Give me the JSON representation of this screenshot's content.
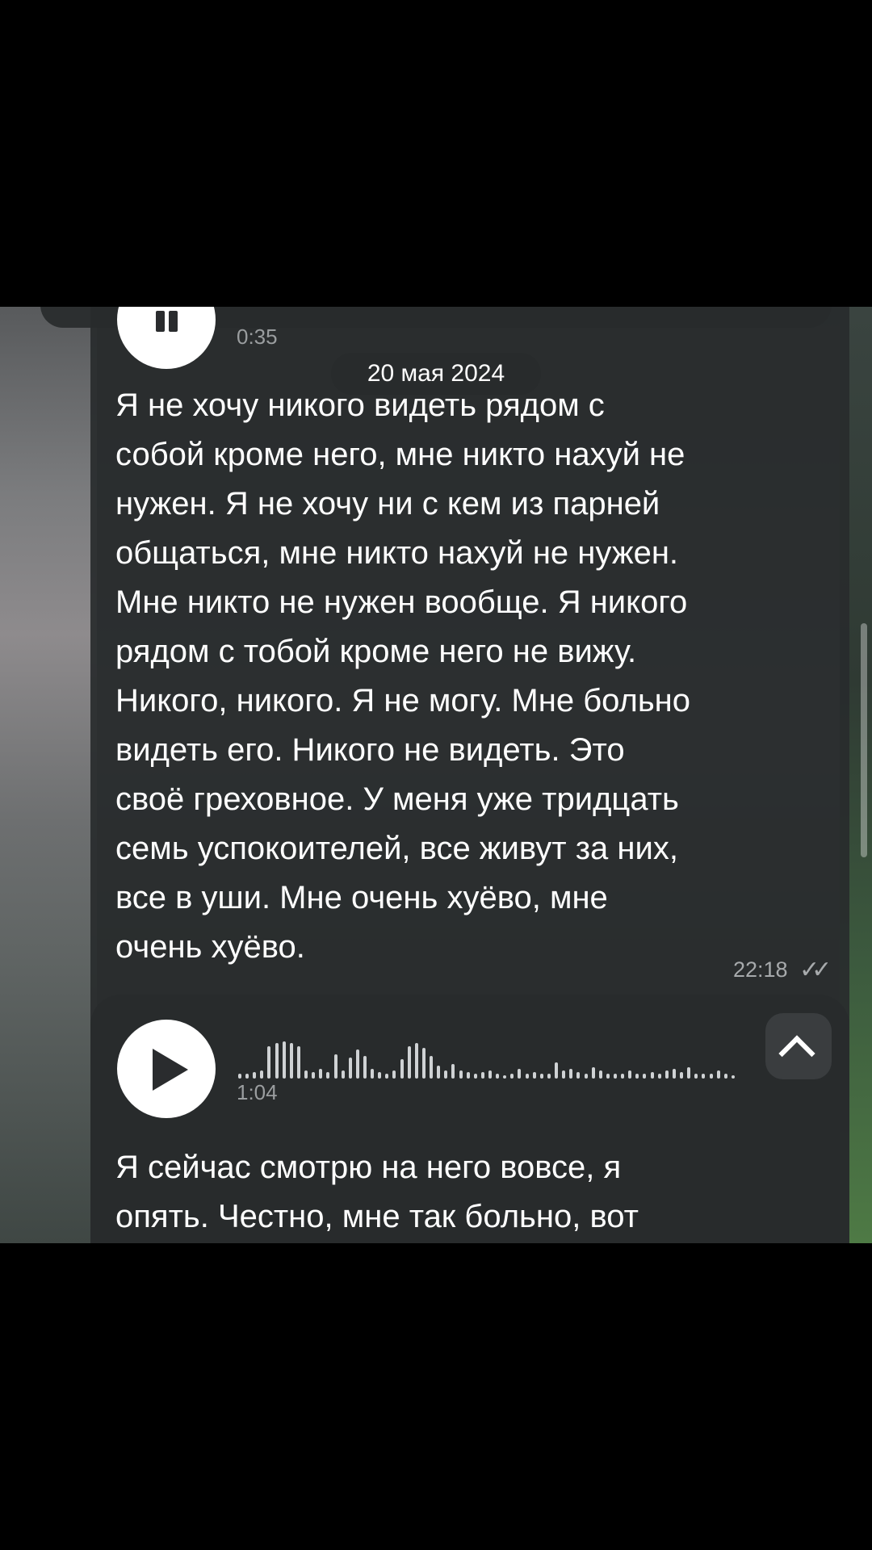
{
  "previous_voice": {
    "duration": "0:35",
    "icon": "pause-icon"
  },
  "date_separator": "20 мая 2024",
  "message_1": {
    "text": "Я не хочу никого видеть рядом с\nсобой кроме него, мне никто нахуй не\nнужен. Я не хочу ни с кем из парней\nобщаться, мне никто нахуй не нужен.\nМне никто не нужен вообще. Я никого\nрядом с тобой кроме него не вижу.\nНикого, никого. Я не могу. Мне больно\nвидеть его. Никого не видеть. Это\nсвоё греховное. У меня уже тридцать\nсемь успокоителей, все живут за них,\nвсе в уши. Мне очень хуёво, мне\nочень хуёво.",
    "time": "22:18",
    "status_icon": "double-check-icon"
  },
  "message_2": {
    "duration": "1:04",
    "play_icon": "play-icon",
    "collapse_icon": "chevron-up-icon",
    "text": "Я сейчас смотрю на него вовсе, я\nопять. Честно, мне так больно, вот"
  },
  "colors": {
    "bubble": "#282b2c",
    "text": "#ffffff",
    "meta": "#a7aaac"
  }
}
